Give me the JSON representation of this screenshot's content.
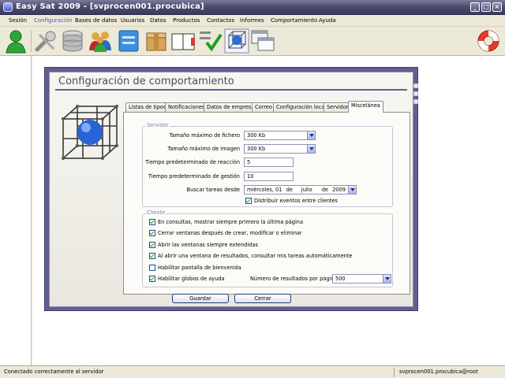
{
  "window": {
    "title": "Easy Sat 2009 - [svprocen001.procubica]"
  },
  "menu": [
    "Sesión",
    "Configuración",
    "Bases de datos",
    "Usuarios",
    "Datos",
    "Productos",
    "Contactos",
    "Informes",
    "Comportamiento",
    "Ayuda"
  ],
  "menu_active_index": 1,
  "toolbar": {
    "icons": [
      "user-icon",
      "tools-icon",
      "database-icon",
      "users-group-icon",
      "contact-card-icon",
      "box-icon",
      "book-icon",
      "checklist-icon",
      "cube-config-icon",
      "windows-icon",
      "lifebuoy-icon"
    ]
  },
  "dialog": {
    "title": "Configuración de comportamiento",
    "tabs": [
      "Listas de tipos",
      "Notificaciones",
      "Datos de empresa",
      "Correo",
      "Configuración local",
      "Servidor",
      "Miscelánea"
    ],
    "active_tab": 6,
    "servidor": {
      "legend": "Servidor",
      "max_file_label": "Tamaño máximo de fichero",
      "max_file_value": "300 Kb",
      "max_image_label": "Tamaño máximo de imagen",
      "max_image_value": "300 Kb",
      "reaction_label": "Tiempo predeterminado de reacción",
      "reaction_value": "5",
      "management_label": "Tiempo predeterminado de gestión",
      "management_value": "10",
      "search_label": "Buscar tareas desde",
      "search_date": {
        "weekday": "miércoles, 01",
        "de1": "de",
        "month": "julio",
        "de2": "de",
        "year": "2009"
      },
      "distribute_label": "Distribuir eventos entre clientes",
      "distribute_checked": true
    },
    "cliente": {
      "legend": "Cliente",
      "options": [
        {
          "label": "En consultas, mostrar siempre primero la última página",
          "checked": true
        },
        {
          "label": "Cerrar ventanas después de crear, modificar o eliminar",
          "checked": true
        },
        {
          "label": "Abrir las ventanas siempre extendidas",
          "checked": true
        },
        {
          "label": "Al abrir una ventana de resultados, consultar mis tareas automáticamente",
          "checked": true
        },
        {
          "label": "Habilitar pantalla de bienvenida",
          "checked": false
        },
        {
          "label": "Habilitar globos de ayuda",
          "checked": true
        }
      ],
      "results_label": "Número de resultados por página",
      "results_value": "500"
    },
    "save_label": "Guardar",
    "close_label": "Cerrar"
  },
  "status": {
    "message": "Conectado correctamente al servidor",
    "user": "svprocen001.procubica@root"
  },
  "colors": {
    "title_bar": "#4d4d70",
    "dialog_frame": "#5f5f92",
    "accent": "#4b56b5"
  }
}
